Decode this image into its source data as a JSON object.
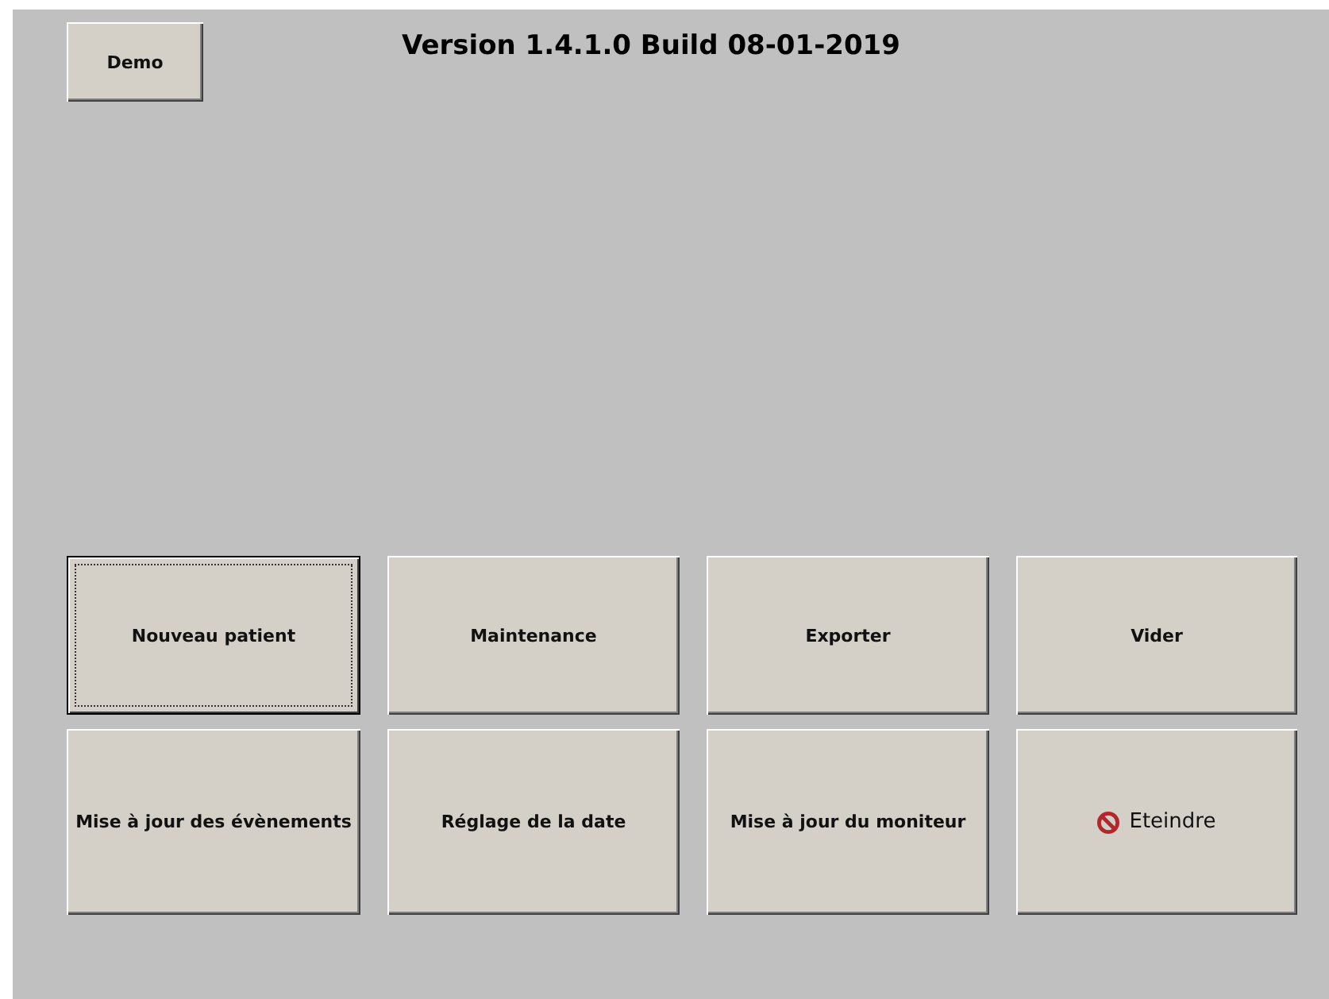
{
  "demo_button": {
    "label": "Demo"
  },
  "version": "Version 1.4.1.0 Build 08-01-2019",
  "buttons": [
    {
      "label": "Nouveau patient",
      "kind": "plain",
      "focused": true
    },
    {
      "label": "Maintenance",
      "kind": "plain",
      "focused": false
    },
    {
      "label": "Exporter",
      "kind": "plain",
      "focused": false
    },
    {
      "label": "Vider",
      "kind": "plain",
      "focused": false
    },
    {
      "label": "Mise à jour des évènements",
      "kind": "plain",
      "focused": false
    },
    {
      "label": "Réglage de la date",
      "kind": "plain",
      "focused": false
    },
    {
      "label": "Mise à jour du moniteur",
      "kind": "plain",
      "focused": false
    },
    {
      "label": "Eteindre",
      "kind": "power",
      "focused": false
    }
  ]
}
